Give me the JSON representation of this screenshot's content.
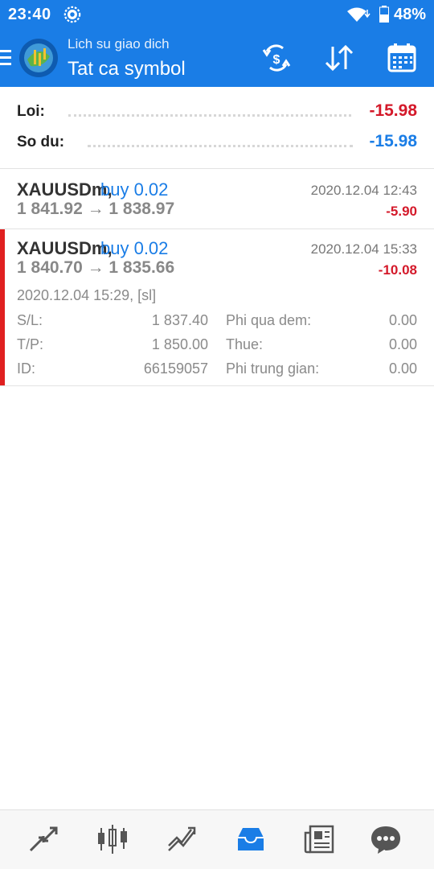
{
  "status_bar": {
    "time": "23:40",
    "battery": "48%",
    "icons": [
      "gear-icon",
      "wifi-icon",
      "battery-icon"
    ]
  },
  "app_bar": {
    "subtitle": "Lich su giao dich",
    "title": "Tat ca symbol",
    "icons": [
      "menu-icon",
      "currency-exchange-icon",
      "sort-icon",
      "calendar-icon"
    ]
  },
  "summary": {
    "profit_label": "Loi:",
    "profit_value": "-15.98",
    "balance_label": "So du:",
    "balance_value": "-15.98"
  },
  "trades": [
    {
      "symbol": "XAUUSDm,",
      "type": "buy 0.02",
      "prices": "1 841.92 → 1 838.97",
      "date": "2020.12.04 12:43",
      "profit": "-5.90"
    },
    {
      "symbol": "XAUUSDm,",
      "type": "buy 0.02",
      "prices": "1 840.70 → 1 835.66",
      "date": "2020.12.04 15:33",
      "profit": "-10.08",
      "details": {
        "open_line": "2020.12.04 15:29, [sl]",
        "sl_label": "S/L:",
        "sl_value": "1 837.40",
        "tp_label": "T/P:",
        "tp_value": "1 850.00",
        "id_label": "ID:",
        "id_value": "66159057",
        "swap_label": "Phi qua dem:",
        "swap_value": "0.00",
        "tax_label": "Thue:",
        "tax_value": "0.00",
        "commission_label": "Phi trung gian:",
        "commission_value": "0.00"
      }
    }
  ],
  "bottom_nav": {
    "items": [
      "quotes-icon",
      "chart-icon",
      "trade-icon",
      "history-icon",
      "news-icon",
      "chat-icon"
    ],
    "active": "history-icon",
    "active_color": "#1a7de6"
  },
  "colors": {
    "accent": "#1a7de6",
    "loss": "#d4192a",
    "marker": "#e02020"
  }
}
